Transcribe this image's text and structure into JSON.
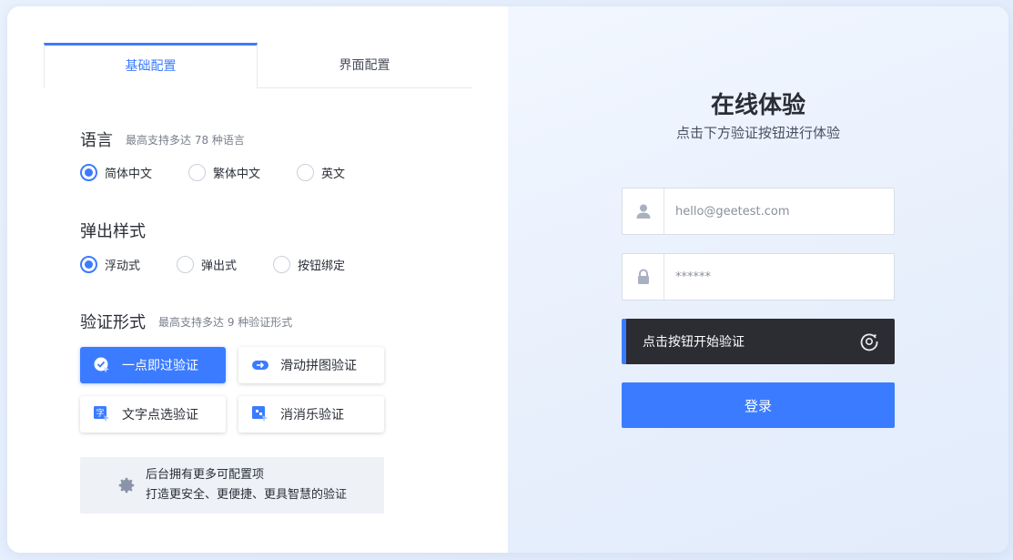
{
  "tabs": {
    "basic": "基础配置",
    "ui": "界面配置"
  },
  "language": {
    "title": "语言",
    "hint": "最高支持多达 78 种语言",
    "options": [
      "简体中文",
      "繁体中文",
      "英文"
    ],
    "selected": 0
  },
  "popup": {
    "title": "弹出样式",
    "options": [
      "浮动式",
      "弹出式",
      "按钮绑定"
    ],
    "selected": 0
  },
  "verify_form": {
    "title": "验证形式",
    "hint": "最高支持多达 9 种验证形式",
    "buttons": [
      "一点即过验证",
      "滑动拼图验证",
      "文字点选验证",
      "消消乐验证"
    ],
    "selected": 0
  },
  "notice": {
    "line1": "后台拥有更多可配置项",
    "line2": "打造更安全、更便捷、更具智慧的验证"
  },
  "demo": {
    "title": "在线体验",
    "subtitle": "点击下方验证按钮进行体验",
    "username_placeholder": "hello@geetest.com",
    "password_placeholder": "******",
    "verify_label": "点击按钮开始验证",
    "login_label": "登录"
  },
  "colors": {
    "accent": "#3b7bff",
    "dark": "#2b2d33"
  }
}
